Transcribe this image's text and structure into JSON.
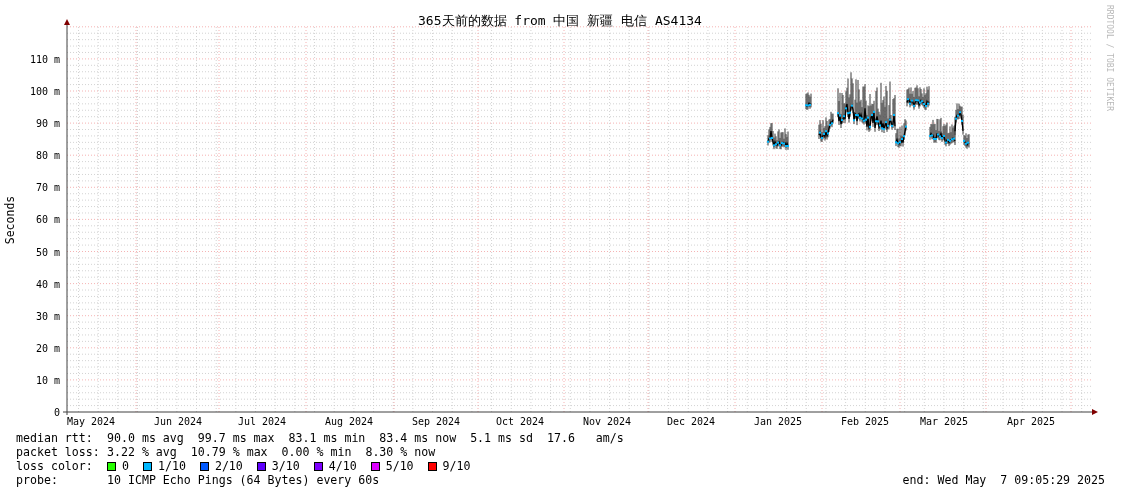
{
  "title": "365天前的数据 from 中国 新疆 电信 AS4134",
  "watermark": "RRDTOOL / TOBI OETIKER",
  "y_axis": {
    "label": "Seconds",
    "ticks": [
      "110 m",
      "100 m",
      "90 m",
      "80 m",
      "70 m",
      "60 m",
      "50 m",
      "40 m",
      "30 m",
      "20 m",
      "10 m",
      "0"
    ]
  },
  "x_axis": {
    "labels": [
      "May 2024",
      "Jun 2024",
      "Jul 2024",
      "Aug 2024",
      "Sep 2024",
      "Oct 2024",
      "Nov 2024",
      "Dec 2024",
      "Jan 2025",
      "Feb 2025",
      "Mar 2025",
      "Apr 2025"
    ]
  },
  "stats": [
    {
      "label": "median rtt:",
      "items": [
        "90.0 ms avg",
        "99.7 ms max",
        "83.1 ms min",
        "83.4 ms now",
        "5.1 ms sd",
        "17.6   am/s"
      ]
    },
    {
      "label": "packet loss:",
      "items": [
        "3.22 % avg",
        "10.79 % max",
        "0.00 % min",
        "8.30 % now"
      ]
    }
  ],
  "loss_color": {
    "label": "loss color:",
    "items": [
      {
        "label": "0",
        "color": "#26ff00"
      },
      {
        "label": "1/10",
        "color": "#00b8ff"
      },
      {
        "label": "2/10",
        "color": "#0059ff"
      },
      {
        "label": "3/10",
        "color": "#5e00ff"
      },
      {
        "label": "4/10",
        "color": "#7e00ff"
      },
      {
        "label": "5/10",
        "color": "#dd00ff"
      },
      {
        "label": "9/10",
        "color": "#ff0000"
      }
    ]
  },
  "probe": {
    "label": "probe:",
    "value": "10 ICMP Echo Pings (64 Bytes) every 60s"
  },
  "end": "end: Wed May  7 09:05:29 2025"
}
